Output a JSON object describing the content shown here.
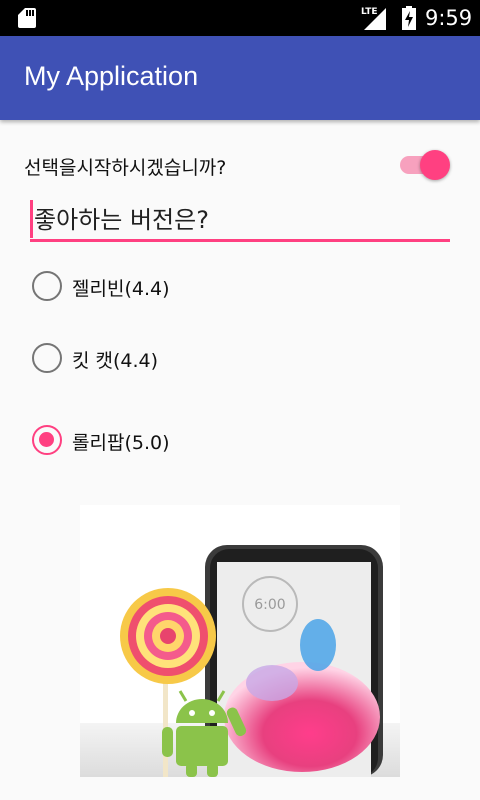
{
  "status_bar": {
    "network_label": "LTE",
    "time": "9:59"
  },
  "app_bar": {
    "title": "My Application"
  },
  "switch_row": {
    "label": "선택을시작하시겠습니까?",
    "checked": true
  },
  "edit_text": {
    "value": "좋아하는 버전은?"
  },
  "radios": [
    {
      "label": "젤리빈(4.4)",
      "checked": false
    },
    {
      "label": "킷 캣(4.4)",
      "checked": false
    },
    {
      "label": "롤리팝(5.0)",
      "checked": true
    }
  ],
  "image": {
    "phone_clock": "6:00"
  },
  "colors": {
    "primary": "#3f51b5",
    "accent": "#ff4081",
    "background": "#fafafa"
  }
}
